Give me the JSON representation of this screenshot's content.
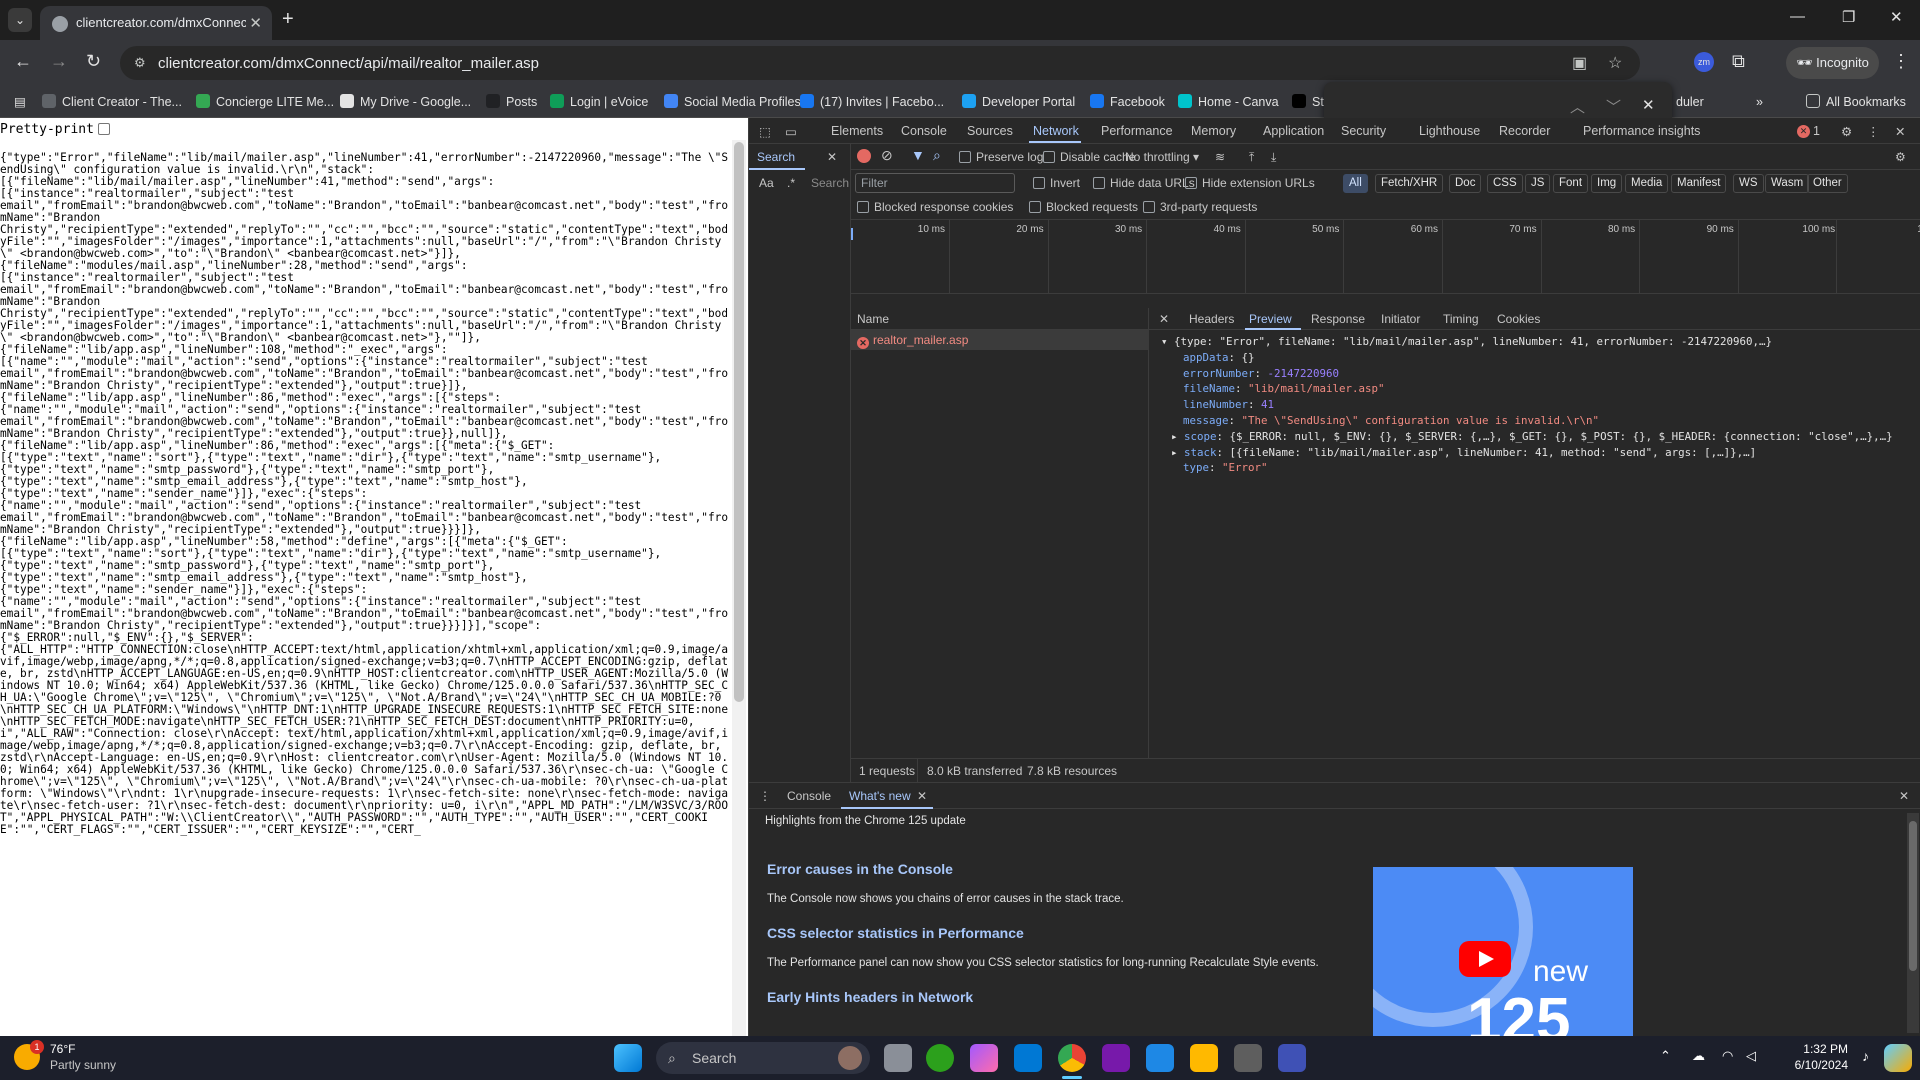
{
  "browser": {
    "tab_title": "clientcreator.com/dmxConnect",
    "url": "clientcreator.com/dmxConnect/api/mail/realtor_mailer.asp",
    "incognito_label": "Incognito",
    "bookmarks": [
      {
        "label": "Client Creator - The...",
        "color": "#5f6368"
      },
      {
        "label": "Concierge LITE Me...",
        "color": "#34a853"
      },
      {
        "label": "My Drive - Google...",
        "color": "#e3e3e3"
      },
      {
        "label": "Posts",
        "color": "#202124"
      },
      {
        "label": "Login | eVoice",
        "color": "#0f9d58"
      },
      {
        "label": "Social Media Profiles",
        "color": "#4285f4"
      },
      {
        "label": "(17) Invites | Facebo...",
        "color": "#1877f2"
      },
      {
        "label": "Developer Portal",
        "color": "#1da1f2"
      },
      {
        "label": "Facebook",
        "color": "#1877f2"
      },
      {
        "label": "Home - Canva",
        "color": "#00c4cc"
      },
      {
        "label": "St",
        "color": "#000000"
      }
    ],
    "bookmarks_overflow": "duler",
    "all_bookmarks": "All Bookmarks"
  },
  "page": {
    "pretty_print_label": "Pretty-print",
    "json_text": "{\"type\":\"Error\",\"fileName\":\"lib/mail/mailer.asp\",\"lineNumber\":41,\"errorNumber\":-2147220960,\"message\":\"The \\\"SendUsing\\\" configuration value is invalid.\\r\\n\",\"stack\":\n[{\"fileName\":\"lib/mail/mailer.asp\",\"lineNumber\":41,\"method\":\"send\",\"args\":\n[{\"instance\":\"realtormailer\",\"subject\":\"test\nemail\",\"fromEmail\":\"brandon@bwcweb.com\",\"toName\":\"Brandon\",\"toEmail\":\"banbear@comcast.net\",\"body\":\"test\",\"fromName\":\"Brandon\nChristy\",\"recipientType\":\"extended\",\"replyTo\":\"\",\"cc\":\"\",\"bcc\":\"\",\"source\":\"static\",\"contentType\":\"text\",\"bodyFile\":\"\",\"imagesFolder\":\"/images\",\"importance\":1,\"attachments\":null,\"baseUrl\":\"/\",\"from\":\"\\\"Brandon Christy\\\" <brandon@bwcweb.com>\",\"to\":\"\\\"Brandon\\\" <banbear@comcast.net>\"}]},\n{\"fileName\":\"modules/mail.asp\",\"lineNumber\":28,\"method\":\"send\",\"args\":\n[{\"instance\":\"realtormailer\",\"subject\":\"test\nemail\",\"fromEmail\":\"brandon@bwcweb.com\",\"toName\":\"Brandon\",\"toEmail\":\"banbear@comcast.net\",\"body\":\"test\",\"fromName\":\"Brandon\nChristy\",\"recipientType\":\"extended\",\"replyTo\":\"\",\"cc\":\"\",\"bcc\":\"\",\"source\":\"static\",\"contentType\":\"text\",\"bodyFile\":\"\",\"imagesFolder\":\"/images\",\"importance\":1,\"attachments\":null,\"baseUrl\":\"/\",\"from\":\"\\\"Brandon Christy\\\" <brandon@bwcweb.com>\",\"to\":\"\\\"Brandon\\\" <banbear@comcast.net>\"},\"\"]},\n{\"fileName\":\"lib/app.asp\",\"lineNumber\":108,\"method\":\"_exec\",\"args\":\n[{\"name\":\"\",\"module\":\"mail\",\"action\":\"send\",\"options\":{\"instance\":\"realtormailer\",\"subject\":\"test\nemail\",\"fromEmail\":\"brandon@bwcweb.com\",\"toName\":\"Brandon\",\"toEmail\":\"banbear@comcast.net\",\"body\":\"test\",\"fromName\":\"Brandon Christy\",\"recipientType\":\"extended\"},\"output\":true}]},\n{\"fileName\":\"lib/app.asp\",\"lineNumber\":86,\"method\":\"exec\",\"args\":[{\"steps\":\n{\"name\":\"\",\"module\":\"mail\",\"action\":\"send\",\"options\":{\"instance\":\"realtormailer\",\"subject\":\"test\nemail\",\"fromEmail\":\"brandon@bwcweb.com\",\"toName\":\"Brandon\",\"toEmail\":\"banbear@comcast.net\",\"body\":\"test\",\"fromName\":\"Brandon Christy\",\"recipientType\":\"extended\"},\"output\":true}},null]},\n{\"fileName\":\"lib/app.asp\",\"lineNumber\":86,\"method\":\"exec\",\"args\":[{\"meta\":{\"$_GET\":\n[{\"type\":\"text\",\"name\":\"sort\"},{\"type\":\"text\",\"name\":\"dir\"},{\"type\":\"text\",\"name\":\"smtp_username\"},\n{\"type\":\"text\",\"name\":\"smtp_password\"},{\"type\":\"text\",\"name\":\"smtp_port\"},\n{\"type\":\"text\",\"name\":\"smtp_email_address\"},{\"type\":\"text\",\"name\":\"smtp_host\"},\n{\"type\":\"text\",\"name\":\"sender_name\"}]},\"exec\":{\"steps\":\n{\"name\":\"\",\"module\":\"mail\",\"action\":\"send\",\"options\":{\"instance\":\"realtormailer\",\"subject\":\"test\nemail\",\"fromEmail\":\"brandon@bwcweb.com\",\"toName\":\"Brandon\",\"toEmail\":\"banbear@comcast.net\",\"body\":\"test\",\"fromName\":\"Brandon Christy\",\"recipientType\":\"extended\"},\"output\":true}}}]},\n{\"fileName\":\"lib/app.asp\",\"lineNumber\":58,\"method\":\"define\",\"args\":[{\"meta\":{\"$_GET\":\n[{\"type\":\"text\",\"name\":\"sort\"},{\"type\":\"text\",\"name\":\"dir\"},{\"type\":\"text\",\"name\":\"smtp_username\"},\n{\"type\":\"text\",\"name\":\"smtp_password\"},{\"type\":\"text\",\"name\":\"smtp_port\"},\n{\"type\":\"text\",\"name\":\"smtp_email_address\"},{\"type\":\"text\",\"name\":\"smtp_host\"},\n{\"type\":\"text\",\"name\":\"sender_name\"}]},\"exec\":{\"steps\":\n{\"name\":\"\",\"module\":\"mail\",\"action\":\"send\",\"options\":{\"instance\":\"realtormailer\",\"subject\":\"test\nemail\",\"fromEmail\":\"brandon@bwcweb.com\",\"toName\":\"Brandon\",\"toEmail\":\"banbear@comcast.net\",\"body\":\"test\",\"fromName\":\"Brandon Christy\",\"recipientType\":\"extended\"},\"output\":true}}}]}],\"scope\":\n{\"$_ERROR\":null,\"$_ENV\":{},\"$_SERVER\":\n{\"ALL_HTTP\":\"HTTP_CONNECTION:close\\nHTTP_ACCEPT:text/html,application/xhtml+xml,application/xml;q=0.9,image/avif,image/webp,image/apng,*/*;q=0.8,application/signed-exchange;v=b3;q=0.7\\nHTTP_ACCEPT_ENCODING:gzip, deflate, br, zstd\\nHTTP_ACCEPT_LANGUAGE:en-US,en;q=0.9\\nHTTP_HOST:clientcreator.com\\nHTTP_USER_AGENT:Mozilla/5.0 (Windows NT 10.0; Win64; x64) AppleWebKit/537.36 (KHTML, like Gecko) Chrome/125.0.0.0 Safari/537.36\\nHTTP_SEC_CH_UA:\\\"Google Chrome\\\";v=\\\"125\\\", \\\"Chromium\\\";v=\\\"125\\\", \\\"Not.A/Brand\\\";v=\\\"24\\\"\\nHTTP_SEC_CH_UA_MOBILE:?0\\nHTTP_SEC_CH_UA_PLATFORM:\\\"Windows\\\"\\nHTTP_DNT:1\\nHTTP_UPGRADE_INSECURE_REQUESTS:1\\nHTTP_SEC_FETCH_SITE:none\\nHTTP_SEC_FETCH_MODE:navigate\\nHTTP_SEC_FETCH_USER:?1\\nHTTP_SEC_FETCH_DEST:document\\nHTTP_PRIORITY:u=0, i\",\"ALL_RAW\":\"Connection: close\\r\\nAccept: text/html,application/xhtml+xml,application/xml;q=0.9,image/avif,image/webp,image/apng,*/*;q=0.8,application/signed-exchange;v=b3;q=0.7\\r\\nAccept-Encoding: gzip, deflate, br, zstd\\r\\nAccept-Language: en-US,en;q=0.9\\r\\nHost: clientcreator.com\\r\\nUser-Agent: Mozilla/5.0 (Windows NT 10.0; Win64; x64) AppleWebKit/537.36 (KHTML, like Gecko) Chrome/125.0.0.0 Safari/537.36\\r\\nsec-ch-ua: \\\"Google Chrome\\\";v=\\\"125\\\", \\\"Chromium\\\";v=\\\"125\\\", \\\"Not.A/Brand\\\";v=\\\"24\\\"\\r\\nsec-ch-ua-mobile: ?0\\r\\nsec-ch-ua-platform: \\\"Windows\\\"\\r\\ndnt: 1\\r\\nupgrade-insecure-requests: 1\\r\\nsec-fetch-site: none\\r\\nsec-fetch-mode: navigate\\r\\nsec-fetch-user: ?1\\r\\nsec-fetch-dest: document\\r\\npriority: u=0, i\\r\\n\",\"APPL_MD_PATH\":\"/LM/W3SVC/3/ROOT\",\"APPL_PHYSICAL_PATH\":\"W:\\\\ClientCreator\\\\\",\"AUTH_PASSWORD\":\"\",\"AUTH_TYPE\":\"\",\"AUTH_USER\":\"\",\"CERT_COOKIE\":\"\",\"CERT_FLAGS\":\"\",\"CERT_ISSUER\":\"\",\"CERT_KEYSIZE\":\"\",\"CERT_"
  },
  "devtools": {
    "panels": [
      "Elements",
      "Console",
      "Sources",
      "Network",
      "Performance",
      "Memory",
      "Application",
      "Security",
      "Lighthouse",
      "Recorder",
      "Performance insights"
    ],
    "error_count": "1",
    "search_tab": "Search",
    "search_aa": "Aa",
    "search_regex": ".*",
    "search_placeholder": "Search",
    "preserve_log": "Preserve log",
    "disable_cache": "Disable cache",
    "throttling": "No throttling",
    "filter_placeholder": "Filter",
    "invert": "Invert",
    "hide_data_urls": "Hide data URLs",
    "hide_extension_urls": "Hide extension URLs",
    "type_filters": [
      "All",
      "Fetch/XHR",
      "Doc",
      "CSS",
      "JS",
      "Font",
      "Img",
      "Media",
      "Manifest",
      "WS",
      "Wasm",
      "Other"
    ],
    "blocked_cookies": "Blocked response cookies",
    "blocked_requests": "Blocked requests",
    "third_party": "3rd-party requests",
    "timeline_ticks": [
      "10 ms",
      "20 ms",
      "30 ms",
      "40 ms",
      "50 ms",
      "60 ms",
      "70 ms",
      "80 ms",
      "90 ms",
      "100 ms",
      "11("
    ],
    "name_header": "Name",
    "request_name": "realtor_mailer.asp",
    "detail_tabs": [
      "Headers",
      "Preview",
      "Response",
      "Initiator",
      "Timing",
      "Cookies"
    ],
    "preview": {
      "summary": "{type: \"Error\", fileName: \"lib/mail/mailer.asp\", lineNumber: 41, errorNumber: -2147220960,…}",
      "appData": "{}",
      "errorNumber": "-2147220960",
      "fileName": "\"lib/mail/mailer.asp\"",
      "lineNumber": "41",
      "message": "\"The \\\"SendUsing\\\" configuration value is invalid.\\r\\n\"",
      "scope": "{$_ERROR: null, $_ENV: {}, $_SERVER: {,…}, $_GET: {}, $_POST: {}, $_HEADER: {connection: \"close\",…},…}",
      "stack": "[{fileName: \"lib/mail/mailer.asp\", lineNumber: 41, method: \"send\", args: [,…]},…]",
      "type": "\"Error\""
    },
    "status": {
      "requests": "1 requests",
      "transferred": "8.0 kB transferred",
      "resources": "7.8 kB resources"
    },
    "drawer": {
      "tabs": [
        "Console",
        "What's new"
      ],
      "highlights": "Highlights from the Chrome 125 update",
      "items": [
        {
          "title": "Error causes in the Console",
          "desc": "The Console now shows you chains of error causes in the stack trace."
        },
        {
          "title": "CSS selector statistics in Performance",
          "desc": "The Performance panel can now show you CSS selector statistics for long-running Recalculate Style events."
        },
        {
          "title": "Early Hints headers in Network",
          "desc": ""
        }
      ],
      "video_new": "new",
      "video_num": "125"
    }
  },
  "taskbar": {
    "weather_temp": "76°F",
    "weather_desc": "Partly sunny",
    "weather_badge": "1",
    "search_label": "Search",
    "time": "1:32 PM",
    "date": "6/10/2024"
  }
}
